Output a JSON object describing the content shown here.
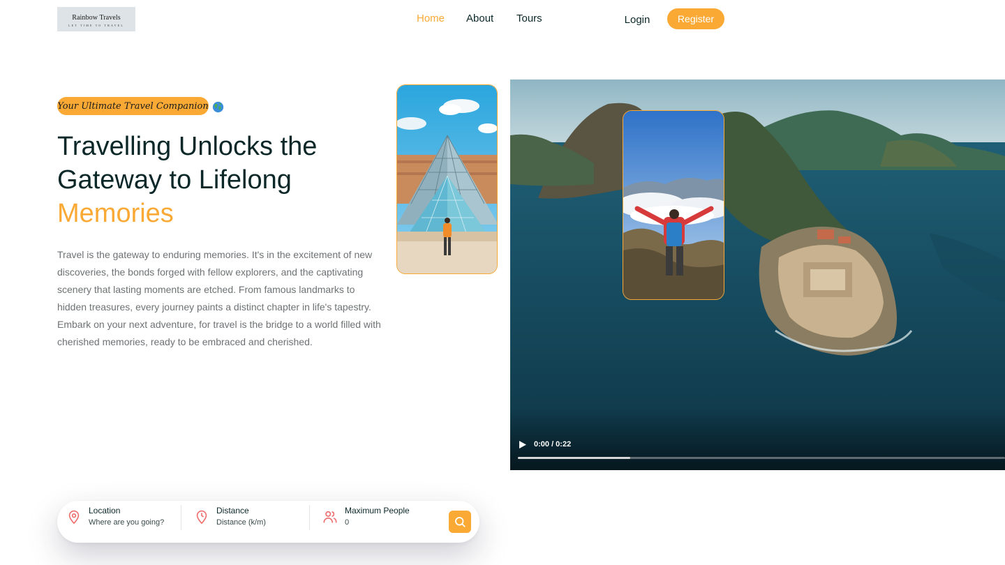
{
  "header": {
    "logo": {
      "title": "Rainbow Travels",
      "tagline": "LET TIME TO TRAVEL"
    },
    "nav": [
      {
        "label": "Home",
        "active": true
      },
      {
        "label": "About",
        "active": false
      },
      {
        "label": "Tours",
        "active": false
      }
    ],
    "login_label": "Login",
    "register_label": "Register"
  },
  "hero": {
    "subtitle": "Your Ultimate Travel Companion",
    "title_line1": "Travelling Unlocks the",
    "title_line2": "Gateway to Lifelong",
    "title_highlight": "Memories",
    "description": "Travel is the gateway to enduring memories. It's in the excitement of new discoveries, the bonds forged with fellow explorers, and the captivating scenery that lasting moments are etched. From famous landmarks to hidden treasures, every journey paints a distinct chapter in life's tapestry. Embark on your next adventure, for travel is the bridge to a world filled with cherished memories, ready to be embraced and cherished."
  },
  "video": {
    "time": "0:00 / 0:22",
    "progress": 0.23
  },
  "search": {
    "location": {
      "label": "Location",
      "placeholder": "Where are you going?"
    },
    "distance": {
      "label": "Distance",
      "placeholder": "Distance (k/m)"
    },
    "people": {
      "label": "Maximum People",
      "placeholder": "0"
    }
  },
  "icons": {
    "location": "map-pin-icon",
    "distance": "clock-icon",
    "people": "users-icon",
    "search": "search-icon",
    "globe": "globe-icon",
    "play": "play-icon"
  },
  "colors": {
    "accent": "#faa935",
    "heading": "#0b2727",
    "text": "#6e7274",
    "icon": "#ee6e6e"
  }
}
